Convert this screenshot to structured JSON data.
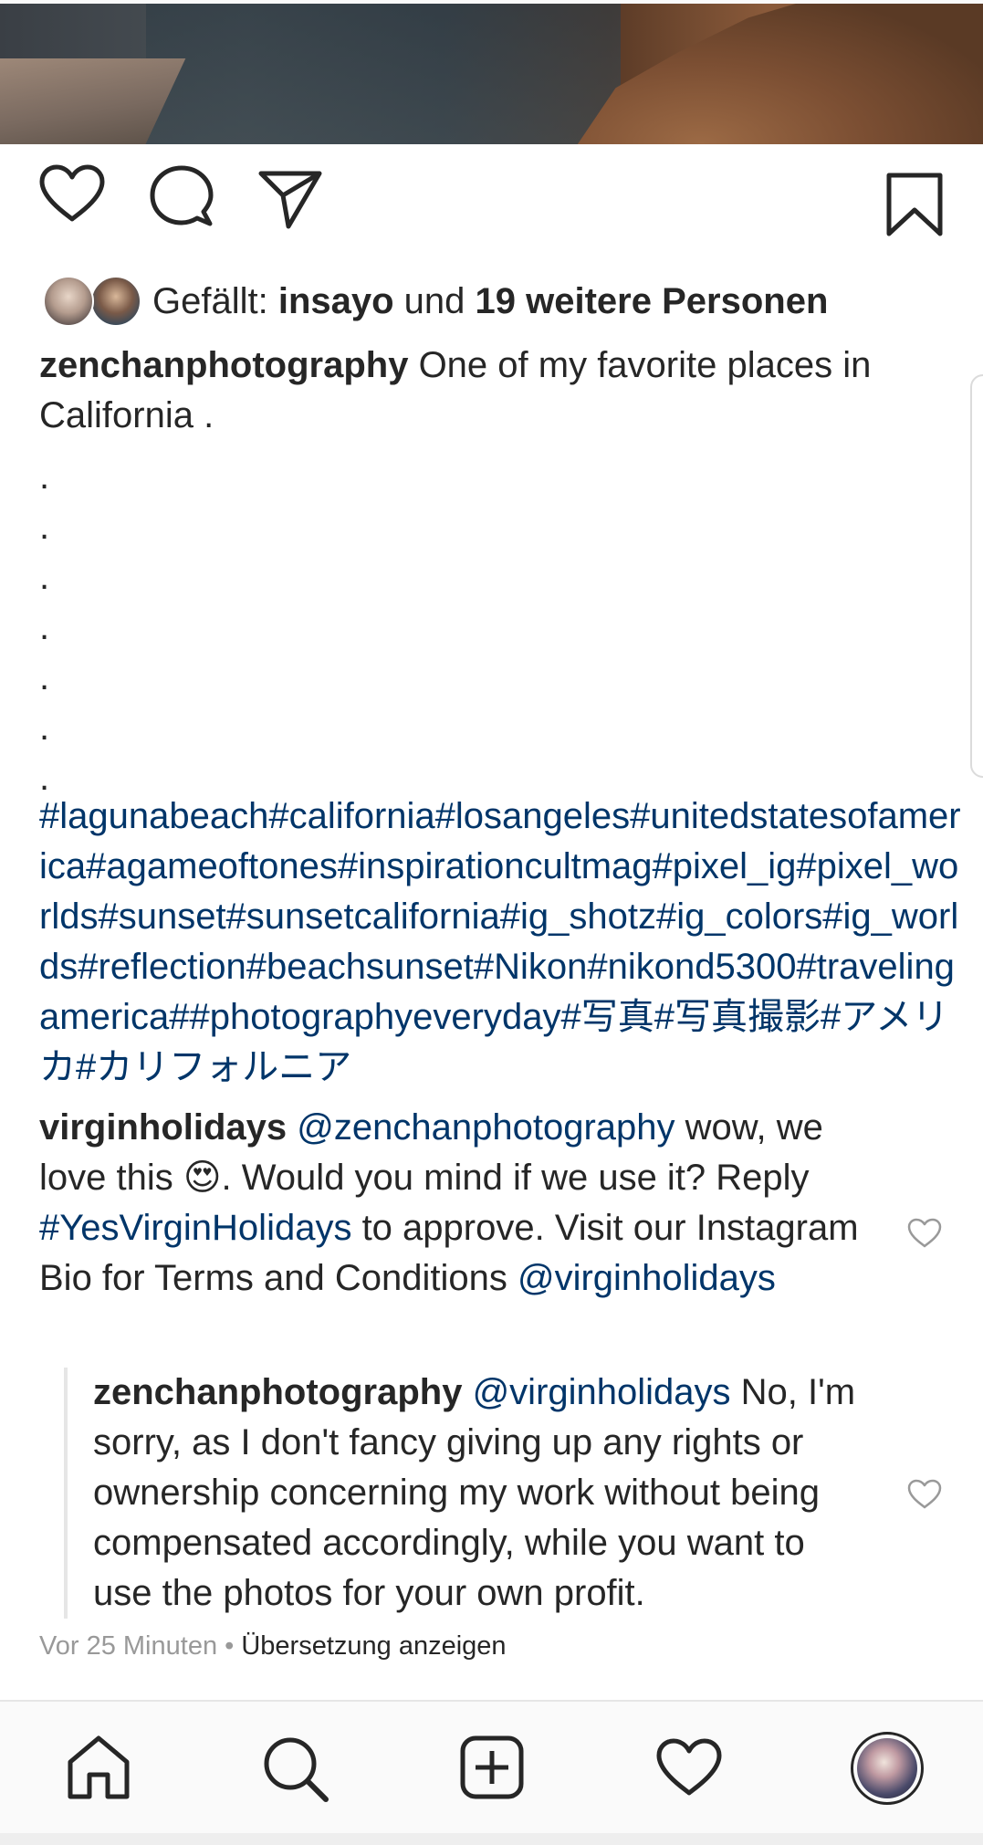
{
  "post": {
    "likes": {
      "prefix": "Gefällt: ",
      "user": "insayo",
      "connector": " und ",
      "others": "19 weitere Personen"
    },
    "caption": {
      "user": "zenchanphotography",
      "text": " One of my favorite places in California ."
    },
    "dots": [
      ".",
      ".",
      ".",
      ".",
      ".",
      ".",
      "."
    ],
    "hashtags": "#lagunabeach#california#losangeles#unitedstatesofamerica#agameoftones#inspirationcultmag#pixel_ig#pixel_worlds#sunset#sunsetcalifornia#ig_shotz#ig_colors#ig_worlds#reflection#beachsunset#Nikon#nikond5300#travelingamerica##photographyeveryday#写真#写真撮影#アメリカ#カリフォルニア"
  },
  "comments": [
    {
      "user": "virginholidays",
      "mention": "@zenchanphotography",
      "text1": " wow, we love this 😍. Would you mind if we use it? Reply ",
      "hashtag": "#YesVirginHolidays",
      "text2": " to approve. Visit our Instagram Bio for Terms and Conditions ",
      "mention2": "@virginholidays"
    },
    {
      "user": "zenchanphotography",
      "mention": "@virginholidays",
      "text": " No, I'm sorry, as I don't fancy giving up any rights or ownership concerning my work without being compensated accordingly, while you want to use the photos for your own profit."
    }
  ],
  "meta": {
    "time": "Vor 25 Minuten",
    "separator": " • ",
    "translate": "Übersetzung anzeigen"
  },
  "icons": {
    "like": "heart-icon",
    "comment": "speech-bubble-icon",
    "share": "paper-plane-icon",
    "save": "bookmark-icon",
    "nav": [
      "home-icon",
      "search-icon",
      "add-post-icon",
      "activity-heart-icon",
      "profile-avatar"
    ]
  }
}
